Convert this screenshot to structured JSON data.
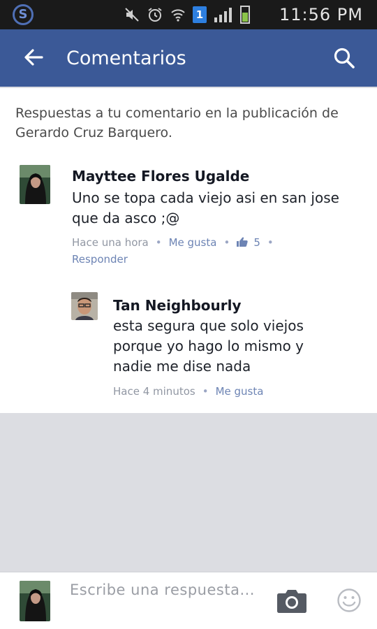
{
  "status_bar": {
    "time": "11:56 PM",
    "sim_badge": "1",
    "icons": [
      "app-s-icon",
      "mute-icon",
      "alarm-icon",
      "wifi-icon",
      "sim-1-icon",
      "signal-icon",
      "battery-icon"
    ]
  },
  "header": {
    "title": "Comentarios",
    "back_icon": "arrow-left-icon",
    "search_icon": "search-icon",
    "color": "#3b5997"
  },
  "notice": "Respuestas a tu comentario en la publicación de Gerardo Cruz Barquero.",
  "comments": [
    {
      "author": "Mayttee Flores Ugalde",
      "text": "Uno se topa cada viejo asi en san jose que da asco ;@",
      "time": "Hace una hora",
      "like_label": "Me gusta",
      "like_count": "5",
      "reply_label": "Responder"
    },
    {
      "author": "Tan Neighbourly",
      "text": "esta segura que solo viejos porque yo hago lo mismo y nadie me dise nada",
      "time": "Hace 4 minutos",
      "like_label": "Me gusta"
    }
  ],
  "composer": {
    "placeholder": "Escribe una respuesta...",
    "camera_icon": "camera-icon",
    "emoji_icon": "smile-icon"
  },
  "colors": {
    "brand": "#3b5997",
    "link": "#6d84b4",
    "meta": "#9197a3",
    "background": "#dcdde2"
  },
  "separator": "•"
}
